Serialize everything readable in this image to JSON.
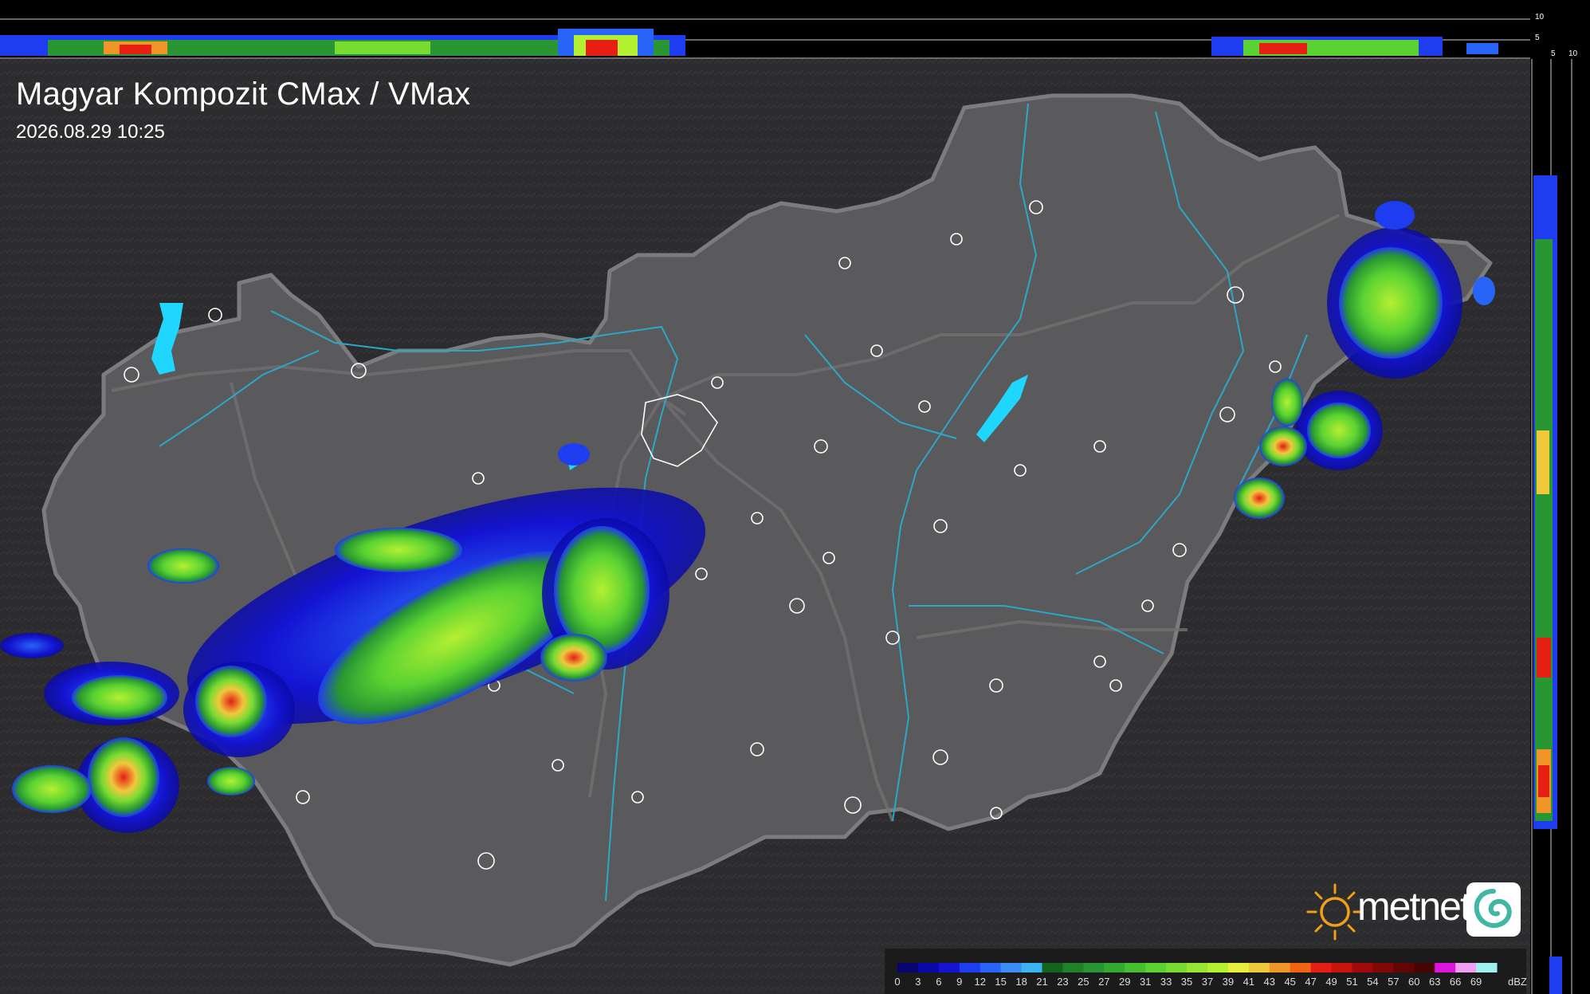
{
  "map": {
    "title": "Magyar Kompozit CMax / VMax",
    "timestamp": "2026.08.29 10:25",
    "brand": "metnet",
    "colors": {
      "background": "#2a2a2c",
      "country_fill": "#5a5a5c",
      "border": "#7c7c7e",
      "river": "#2ba7c8",
      "lake": "#1fd6ff",
      "city_outline": "#ffffff",
      "brand_sun": "#f0a018",
      "brand_tile": "#ffffff",
      "brand_swirl": "#3fb7a3"
    }
  },
  "legend": {
    "unit": "dBZ",
    "ticks": [
      "0",
      "3",
      "6",
      "9",
      "12",
      "15",
      "18",
      "21",
      "23",
      "25",
      "27",
      "29",
      "31",
      "33",
      "35",
      "37",
      "39",
      "41",
      "43",
      "45",
      "47",
      "49",
      "51",
      "54",
      "57",
      "60",
      "63",
      "66",
      "69"
    ],
    "colors": [
      "#06066e",
      "#0a0aa8",
      "#1414d2",
      "#1e3cf0",
      "#2864f8",
      "#3c8cf8",
      "#3cb4f0",
      "#14641e",
      "#1e8228",
      "#289632",
      "#32aa32",
      "#46be32",
      "#5ad232",
      "#78dc32",
      "#96e632",
      "#b4f032",
      "#e6f03c",
      "#f0c83c",
      "#f09628",
      "#f06414",
      "#e61e14",
      "#c8140a",
      "#a00a0a",
      "#820808",
      "#640404",
      "#460404",
      "#dc14dc",
      "#f0a0f0",
      "#a0f0f0"
    ]
  },
  "side_profile": {
    "scale_top": [
      "10",
      "5"
    ],
    "scale_right": [
      "5",
      "10"
    ]
  }
}
